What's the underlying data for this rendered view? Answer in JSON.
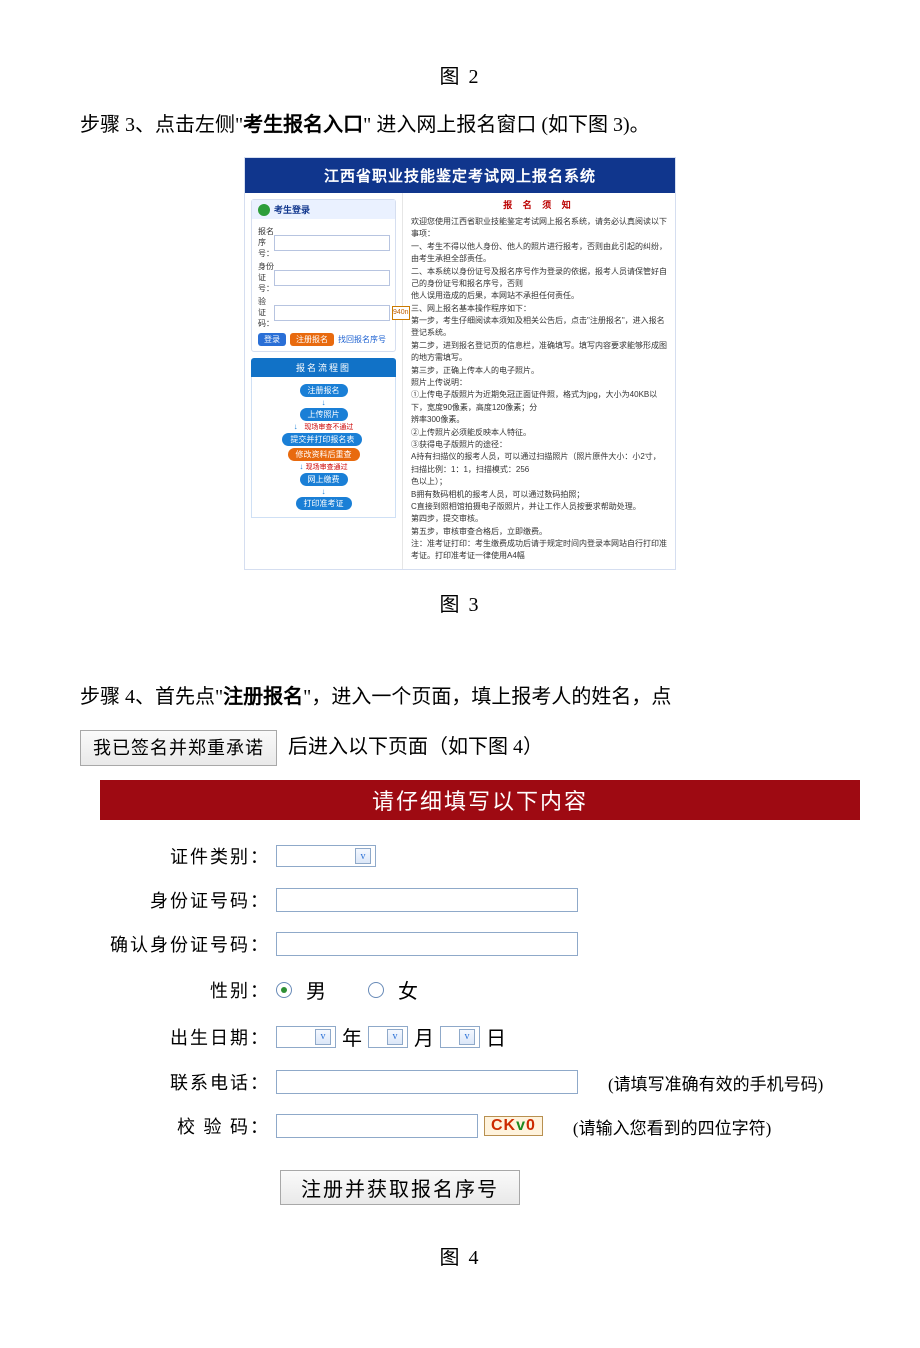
{
  "captions": {
    "fig2": "图 2",
    "fig3": "图 3",
    "fig4": "图 4"
  },
  "step3": {
    "pre": "步骤 3、点击左侧\"",
    "bold": "考生报名入口",
    "post": "\" 进入网上报名窗口 (如下图 3)。"
  },
  "shot1": {
    "banner": "江西省职业技能鉴定考试网上报名系统",
    "login": {
      "title": "考生登录",
      "f1": "报名序号：",
      "f2": "身份证号：",
      "f3": "验 证 码：",
      "code": "940n",
      "btn_login": "登录",
      "btn_reg": "注册报名",
      "link": "找回报名序号"
    },
    "flow": {
      "title": "报名流程图",
      "s1": "注册报名",
      "s2": "上传照片",
      "warn1": "现场审查不通过",
      "s3a": "提交并打印报名表",
      "s3b": "修改资料后重查",
      "warn2": "现场审查通过",
      "s4": "网上缴费",
      "s5": "打印准考证"
    },
    "notice": {
      "title": "报 名 须 知",
      "l0": "欢迎您使用江西省职业技能鉴定考试网上报名系统，请务必认真阅读以下事项：",
      "l1": "一、考生不得以他人身份、他人的照片进行报考，否则由此引起的纠纷，由考生承担全部责任。",
      "l2": "二、本系统以身份证号及报名序号作为登录的依据，报考人员请保管好自己的身份证号和报名序号，否则",
      "l2b": "他人误用造成的后果，本网站不承担任何责任。",
      "l3": "三、网上报名基本操作程序如下：",
      "l4": "第一步，考生仔细阅读本须知及相关公告后，点击\"注册报名\"，进入报名登记系统。",
      "l5": "第二步，进到报名登记页的信息栏，准确填写。填写内容要求能够形成图的地方需填写。",
      "l6": "第三步，正确上传本人的电子照片。",
      "l7": "照片上传说明：",
      "l8": "①上传电子版照片为近期免冠正面证件照，格式为jpg，大小为40KB以下，宽度90像素，高度120像素；分",
      "l8b": "辨率300像素。",
      "l9": "②上传照片必须能反映本人特征。",
      "l10": "③获得电子版照片的途径：",
      "l11": "A持有扫描仪的报考人员，可以通过扫描照片（照片原件大小：小2寸，扫描比例：1：1，扫描模式：256",
      "l11b": "色以上）；",
      "l12": "B拥有数码相机的报考人员，可以通过数码拍照；",
      "l13": "C直接到照相馆拍摄电子版照片，并让工作人员按要求帮助处理。",
      "l14": "第四步，提交审核。",
      "l15": "第五步，审核审查合格后，立即缴费。",
      "l16": "注：准考证打印：考生缴费成功后请于规定时间内登录本网站自行打印准考证。打印准考证一律使用A4幅"
    }
  },
  "step4": {
    "line1_pre": "步骤 4、首先点\"",
    "line1_bold": "注册报名",
    "line1_post": "\"，进入一个页面，填上报考人的姓名，点",
    "btn": "我已签名并郑重承诺",
    "line2": "后进入以下页面（如下图 4）"
  },
  "form": {
    "title": "请仔细填写以下内容",
    "labels": {
      "cert": "证件类别：",
      "id": "身份证号码：",
      "id2": "确认身份证号码：",
      "gender": "性别：",
      "birth": "出生日期：",
      "phone": "联系电话：",
      "captcha": "校 验 码："
    },
    "gender": {
      "m": "男",
      "f": "女"
    },
    "date": {
      "y": "年",
      "m": "月",
      "d": "日"
    },
    "hints": {
      "phone": "(请填写准确有效的手机号码)",
      "captcha": "(请输入您看到的四位字符)"
    },
    "captcha_img": {
      "a": "CK",
      "b": "v",
      "c": "0"
    },
    "submit": "注册并获取报名序号"
  }
}
